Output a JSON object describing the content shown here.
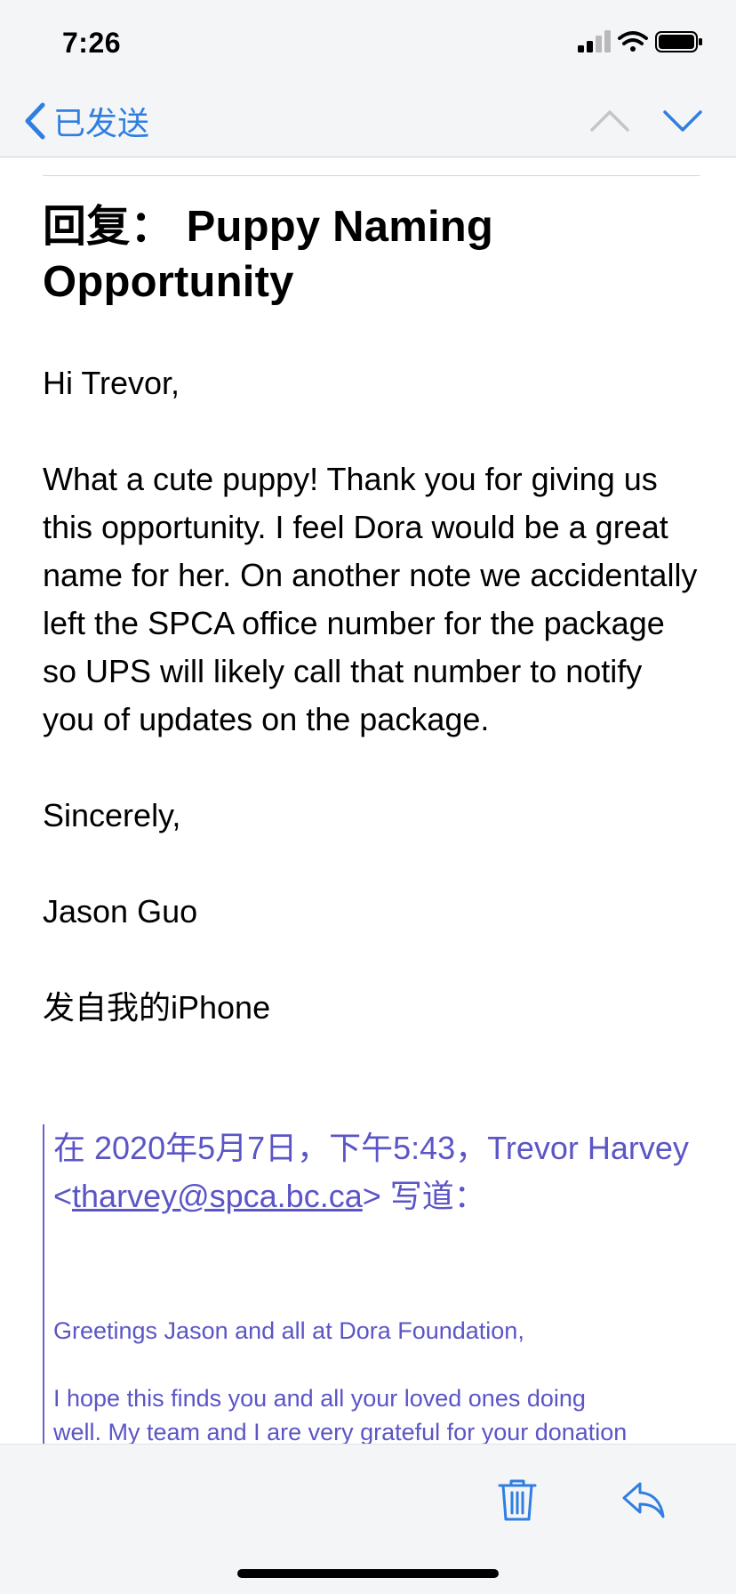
{
  "status_bar": {
    "time": "7:26"
  },
  "nav": {
    "back_label": "已发送"
  },
  "email": {
    "subject_prefix": "回复：",
    "subject": "Puppy Naming Opportunity",
    "greeting": "Hi Trevor,",
    "body": "What a cute puppy! Thank you for giving us this opportunity. I feel Dora would be a great name for her. On another note we accidentally left the SPCA office number for the package so UPS will likely call that number to notify you of updates on the package.",
    "closing": "Sincerely,",
    "signature_name": "Jason Guo",
    "sent_from": "发自我的iPhone"
  },
  "quote": {
    "header_prefix": "在 2020年5月7日，下午5:43，Trevor Harvey <",
    "email": "tharvey@spca.bc.ca",
    "header_suffix": "> 写道：",
    "greeting": "Greetings Jason and all at Dora Foundation,",
    "line1": "I hope this finds you and all your loved ones doing",
    "line2": "well. My team and I are very grateful for your donation"
  },
  "colors": {
    "accent": "#2f7ee0",
    "quote": "#5b55c6"
  }
}
